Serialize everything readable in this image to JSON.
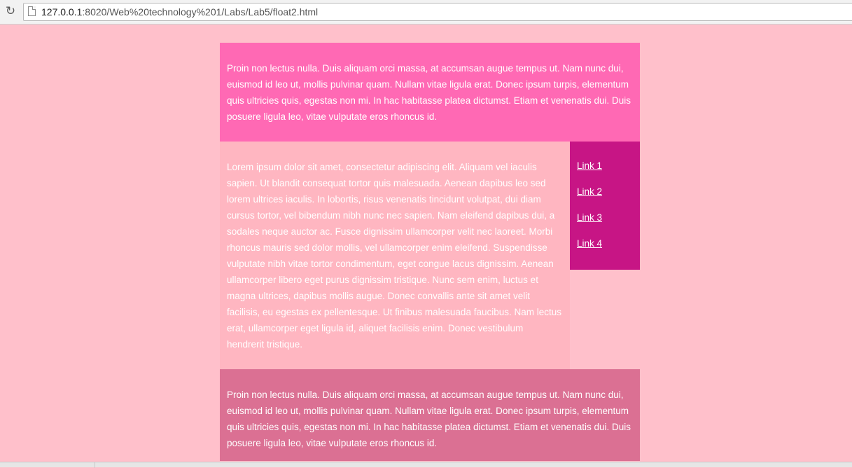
{
  "browser": {
    "url_host": "127.0.0.1",
    "url_path": ":8020/Web%20technology%201/Labs/Lab5/float2.html"
  },
  "page": {
    "header_text": "Proin non lectus nulla. Duis aliquam orci massa, at accumsan augue tempus ut. Nam nunc dui, euismod id leo ut, mollis pulvinar quam. Nullam vitae ligula erat. Donec ipsum turpis, elementum quis ultricies quis, egestas non mi. In hac habitasse platea dictumst. Etiam et venenatis dui. Duis posuere ligula leo, vitae vulputate eros rhoncus id.",
    "main_text": "Lorem ipsum dolor sit amet, consectetur adipiscing elit. Aliquam vel iaculis sapien. Ut blandit consequat tortor quis malesuada. Aenean dapibus leo sed lorem ultrices iaculis. In lobortis, risus venenatis tincidunt volutpat, dui diam cursus tortor, vel bibendum nibh nunc nec sapien. Nam eleifend dapibus dui, a sodales neque auctor ac. Fusce dignissim ullamcorper velit nec laoreet. Morbi rhoncus mauris sed dolor mollis, vel ullamcorper enim eleifend. Suspendisse vulputate nibh vitae tortor condimentum, eget congue lacus dignissim. Aenean ullamcorper libero eget purus dignissim tristique. Nunc sem enim, luctus et magna ultrices, dapibus mollis augue. Donec convallis ante sit amet velit facilisis, eu egestas ex pellentesque. Ut finibus malesuada faucibus. Nam lectus erat, ullamcorper eget ligula id, aliquet facilisis enim. Donec vestibulum hendrerit tristique.",
    "sidebar_links": [
      "Link 1",
      "Link 2",
      "Link 3",
      "Link 4"
    ],
    "footer_text": "Proin non lectus nulla. Duis aliquam orci massa, at accumsan augue tempus ut. Nam nunc dui, euismod id leo ut, mollis pulvinar quam. Nullam vitae ligula erat. Donec ipsum turpis, elementum quis ultricies quis, egestas non mi. In hac habitasse platea dictumst. Etiam et venenatis dui. Duis posuere ligula leo, vitae vulputate eros rhoncus id."
  },
  "colors": {
    "background": "#ffc0cb",
    "header": "#ff69b4",
    "main": "#ffb6c1",
    "sidebar": "#c71585",
    "footer": "#db7093"
  },
  "icons": {
    "reload": "reload-icon",
    "page": "page-icon"
  }
}
